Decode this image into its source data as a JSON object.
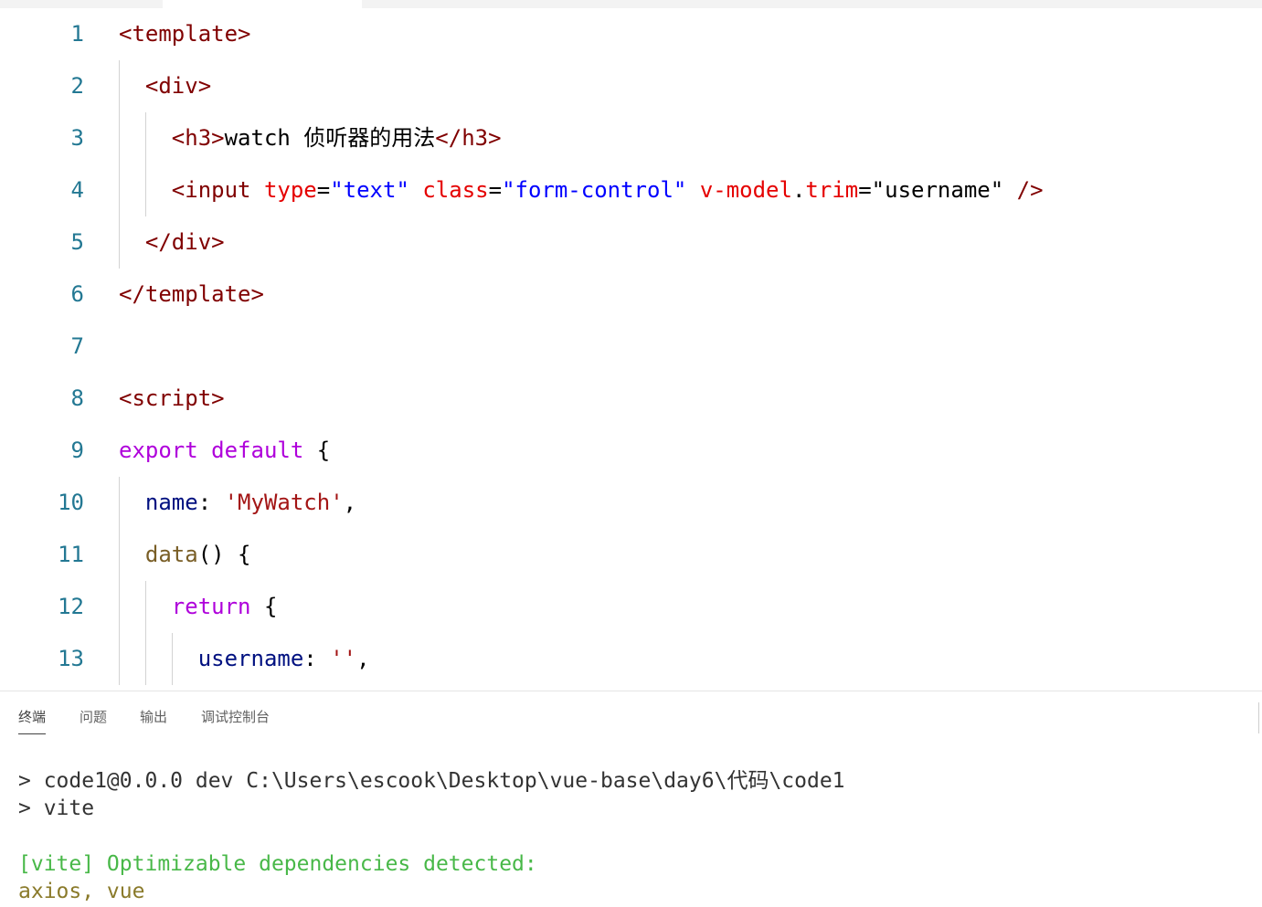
{
  "editor": {
    "lines": [
      {
        "number": "1",
        "tokens": [
          {
            "t": "<template>",
            "c": "tag"
          }
        ]
      },
      {
        "number": "2",
        "tokens": [
          {
            "t": "  <div>",
            "c": "tag"
          }
        ]
      },
      {
        "number": "3",
        "tokens": [
          {
            "t": "    <h3>",
            "c": "tag"
          },
          {
            "t": "watch ",
            "c": "plain"
          },
          {
            "t": "侦听器的用法",
            "c": "cjk"
          },
          {
            "t": "</h3>",
            "c": "tag"
          }
        ]
      },
      {
        "number": "4",
        "tokens": [
          {
            "t": "    <input ",
            "c": "tag"
          },
          {
            "t": "type",
            "c": "attr"
          },
          {
            "t": "=",
            "c": "plain"
          },
          {
            "t": "\"text\"",
            "c": "str"
          },
          {
            "t": " ",
            "c": "plain"
          },
          {
            "t": "class",
            "c": "attr"
          },
          {
            "t": "=",
            "c": "plain"
          },
          {
            "t": "\"form-control\"",
            "c": "str"
          },
          {
            "t": " ",
            "c": "plain"
          },
          {
            "t": "v-model",
            "c": "attr"
          },
          {
            "t": ".",
            "c": "plain"
          },
          {
            "t": "trim",
            "c": "attr"
          },
          {
            "t": "=",
            "c": "plain"
          },
          {
            "t": "\"username\"",
            "c": "plain"
          },
          {
            "t": " />",
            "c": "tag"
          }
        ]
      },
      {
        "number": "5",
        "tokens": [
          {
            "t": "  </div>",
            "c": "tag"
          }
        ]
      },
      {
        "number": "6",
        "tokens": [
          {
            "t": "</template>",
            "c": "tag"
          }
        ]
      },
      {
        "number": "7",
        "tokens": []
      },
      {
        "number": "8",
        "tokens": [
          {
            "t": "<script>",
            "c": "tag"
          }
        ]
      },
      {
        "number": "9",
        "tokens": [
          {
            "t": "export",
            "c": "kw"
          },
          {
            "t": " ",
            "c": "plain"
          },
          {
            "t": "default",
            "c": "kw"
          },
          {
            "t": " {",
            "c": "plain"
          }
        ]
      },
      {
        "number": "10",
        "tokens": [
          {
            "t": "  name",
            "c": "prop"
          },
          {
            "t": ": ",
            "c": "plain"
          },
          {
            "t": "'MyWatch'",
            "c": "sq"
          },
          {
            "t": ",",
            "c": "plain"
          }
        ]
      },
      {
        "number": "11",
        "tokens": [
          {
            "t": "  data",
            "c": "fn"
          },
          {
            "t": "() {",
            "c": "plain"
          }
        ]
      },
      {
        "number": "12",
        "tokens": [
          {
            "t": "    return",
            "c": "kw"
          },
          {
            "t": " {",
            "c": "plain"
          }
        ]
      },
      {
        "number": "13",
        "tokens": [
          {
            "t": "      username",
            "c": "prop"
          },
          {
            "t": ": ",
            "c": "plain"
          },
          {
            "t": "''",
            "c": "sq"
          },
          {
            "t": ",",
            "c": "plain"
          }
        ]
      }
    ]
  },
  "panel": {
    "tabs": [
      {
        "label": "终端",
        "active": true
      },
      {
        "label": "问题",
        "active": false
      },
      {
        "label": "输出",
        "active": false
      },
      {
        "label": "调试控制台",
        "active": false
      }
    ]
  },
  "terminal": {
    "line1": "> code1@0.0.0 dev C:\\Users\\escook\\Desktop\\vue-base\\day6\\代码\\code1",
    "line2": "> vite",
    "line3": "[vite] Optimizable dependencies detected:",
    "line4": "axios, vue"
  },
  "colors": {
    "tag": "#800000",
    "attr": "#e50000",
    "str": "#0000ff",
    "kw": "#af00db",
    "fn": "#795e26",
    "prop": "#001080",
    "sq": "#a31515",
    "line_number": "#237893",
    "terminal_green": "#48b848",
    "terminal_olive": "#8a7a2a"
  }
}
